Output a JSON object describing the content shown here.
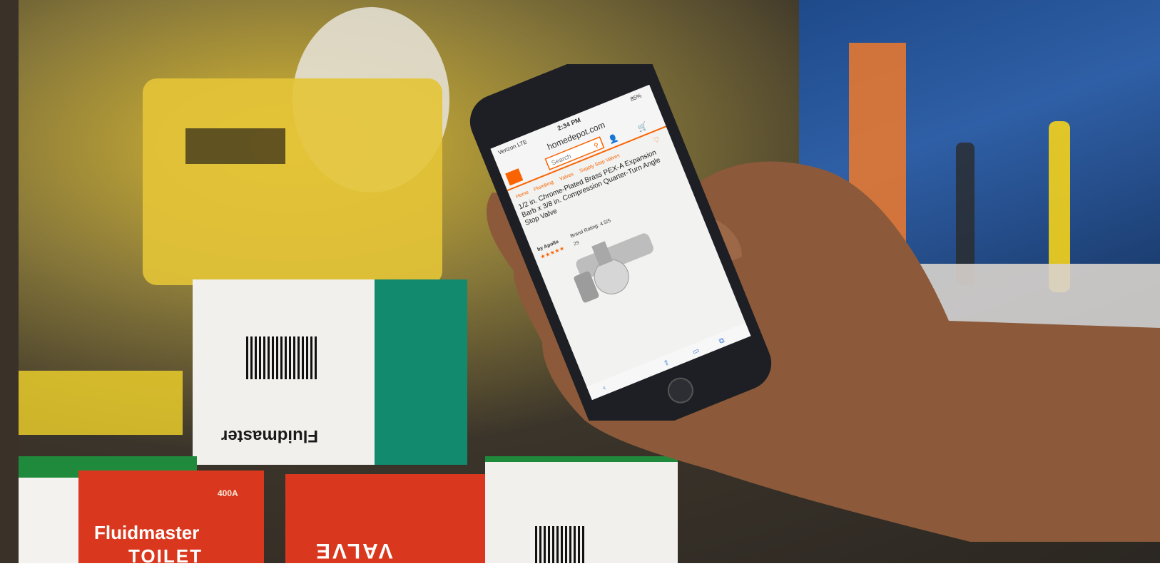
{
  "phone": {
    "status": {
      "carrier": "Verizon  LTE",
      "time": "2:34 PM",
      "battery": "85%"
    },
    "url": "homedepot.com",
    "search_placeholder": "Search",
    "breadcrumb": [
      "Home",
      "Plumbing",
      "Valves",
      "Supply Stop Valves"
    ],
    "product_title": "1/2 in. Chrome-Plated Brass PEX-A Expansion Barb x 3/8 in. Compression Quarter-Turn Angle Stop Valve",
    "brand_line": "by Apollo",
    "brand_rating": "Brand Rating: 4.5/5",
    "review_count": "29"
  },
  "boxes": {
    "brand": "Fluidmaster",
    "label_toilet": "TOILET",
    "label_valve": "VALVE",
    "model": "400A"
  },
  "colors": {
    "accent_orange": "#f96302",
    "box_red": "#d9381e",
    "box_green": "#1f8a3b"
  }
}
